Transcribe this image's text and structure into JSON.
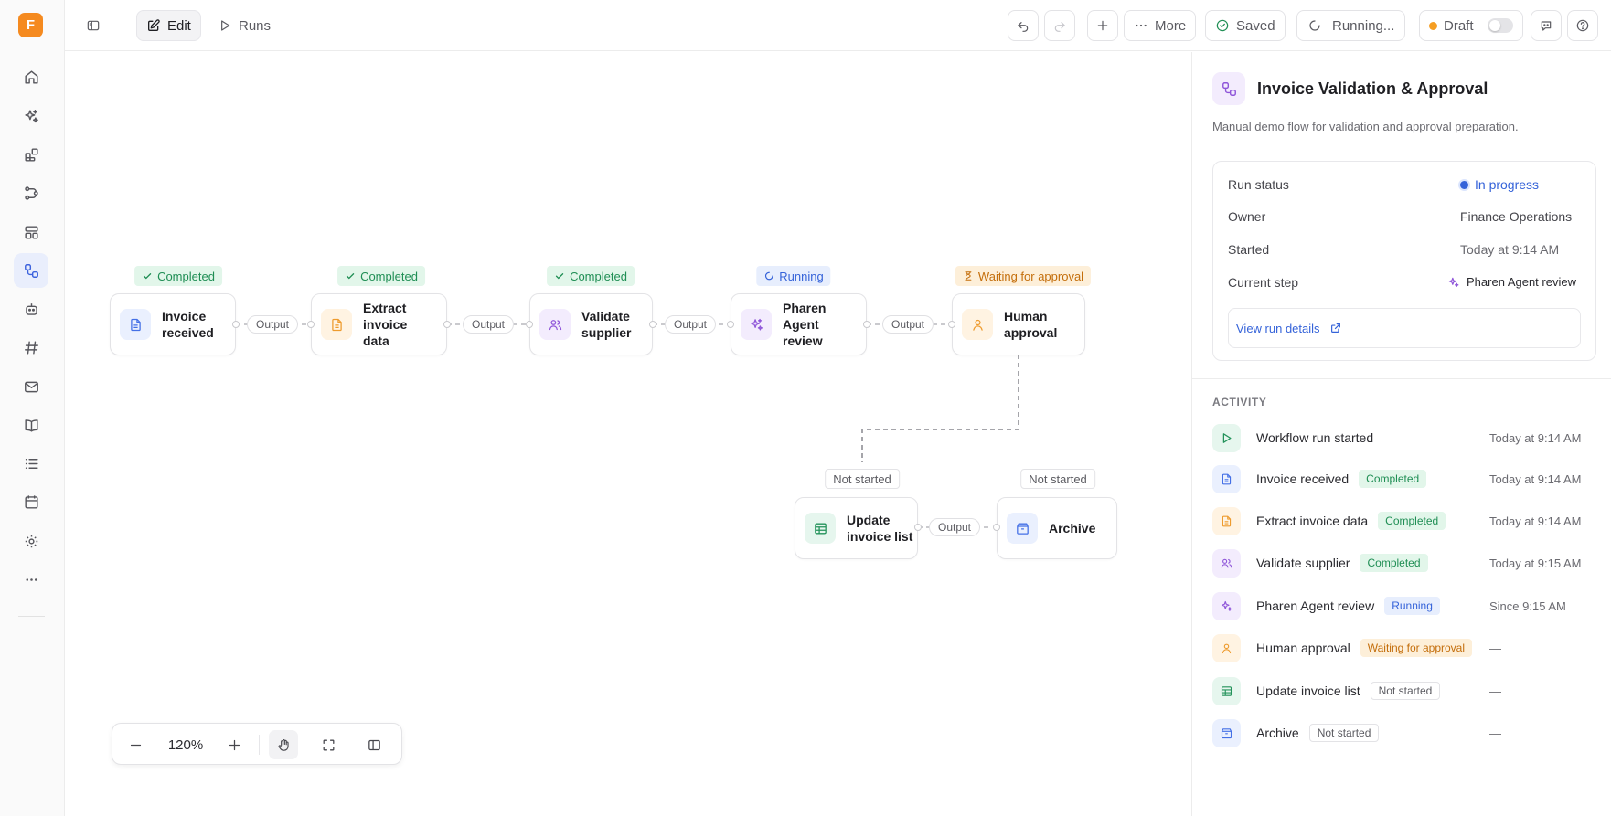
{
  "app": {
    "logo_letter": "F"
  },
  "rail": {
    "items": [
      {
        "icon": "home-icon"
      },
      {
        "icon": "sparkles-icon"
      },
      {
        "icon": "blocks-icon"
      },
      {
        "icon": "flows-icon"
      },
      {
        "icon": "templates-icon"
      },
      {
        "icon": "workflow-icon",
        "active": true
      },
      {
        "icon": "bot-icon"
      },
      {
        "icon": "hash-icon"
      },
      {
        "icon": "mail-icon"
      },
      {
        "icon": "book-icon"
      },
      {
        "icon": "list-icon"
      },
      {
        "icon": "calendar-icon"
      },
      {
        "icon": "settings-icon"
      },
      {
        "icon": "more-icon"
      }
    ]
  },
  "topbar": {
    "edit_label": "Edit",
    "runs_label": "Runs",
    "more_label": "More",
    "saved_label": "Saved",
    "running_label": "Running...",
    "draft_label": "Draft"
  },
  "canvas": {
    "nodes": [
      {
        "id": "invoice-received",
        "label": "Invoice received",
        "status": "Completed",
        "color": "blue",
        "icon": "document-icon"
      },
      {
        "id": "extract-invoice-data",
        "label": "Extract invoice data",
        "status": "Completed",
        "color": "orange",
        "icon": "document-icon"
      },
      {
        "id": "validate-supplier",
        "label": "Validate supplier",
        "status": "Completed",
        "color": "purple",
        "icon": "users-icon"
      },
      {
        "id": "pharen-agent-review",
        "label": "Pharen Agent review",
        "status": "Running",
        "color": "purple",
        "icon": "sparkles-icon"
      },
      {
        "id": "human-approval",
        "label": "Human approval",
        "status": "Waiting for approval",
        "color": "orange",
        "icon": "person-icon"
      },
      {
        "id": "update-invoice-list",
        "label": "Update invoice list",
        "status": "Not started",
        "color": "green",
        "icon": "table-icon"
      },
      {
        "id": "archive",
        "label": "Archive",
        "status": "Not started",
        "color": "blue",
        "icon": "archive-icon"
      }
    ],
    "edge_label": "Output",
    "zoom": "120%"
  },
  "panel": {
    "title": "Invoice Validation & Approval",
    "description": "Manual demo flow for validation and approval preparation.",
    "details": {
      "run_status_label": "Run status",
      "run_status_value": "In progress",
      "owner_label": "Owner",
      "owner_value": "Finance Operations",
      "started_label": "Started",
      "started_value": "Today at 9:14 AM",
      "current_step_label": "Current step",
      "current_step_value": "Pharen Agent review",
      "view_run_label": "View run details"
    },
    "activity_heading": "ACTIVITY",
    "activity": [
      {
        "name": "Workflow run started",
        "badge": "",
        "time": "Today at 9:14 AM",
        "color": "green",
        "icon": "play-icon"
      },
      {
        "name": "Invoice received",
        "badge": "Completed",
        "badge_type": "green",
        "time": "Today at 9:14 AM",
        "color": "blue",
        "icon": "document-icon"
      },
      {
        "name": "Extract invoice data",
        "badge": "Completed",
        "badge_type": "green",
        "time": "Today at 9:14 AM",
        "color": "orange",
        "icon": "document-icon"
      },
      {
        "name": "Validate supplier",
        "badge": "Completed",
        "badge_type": "green",
        "time": "Today at 9:15 AM",
        "color": "purple",
        "icon": "users-icon"
      },
      {
        "name": "Pharen Agent review",
        "badge": "Running",
        "badge_type": "blue",
        "time": "Since 9:15 AM",
        "color": "purple",
        "icon": "sparkles-icon"
      },
      {
        "name": "Human approval",
        "badge": "Waiting for approval",
        "badge_type": "amber",
        "time": "—",
        "color": "orange",
        "icon": "person-icon"
      },
      {
        "name": "Update invoice list",
        "badge": "Not started",
        "badge_type": "gray",
        "time": "—",
        "color": "green",
        "icon": "table-icon"
      },
      {
        "name": "Archive",
        "badge": "Not started",
        "badge_type": "gray",
        "time": "—",
        "color": "blue",
        "icon": "archive-icon"
      }
    ]
  },
  "colors": {
    "accent": "#3d63dd",
    "brand": "#f58a1f",
    "completed": "#1f8e54",
    "running": "#3563d9",
    "waiting": "#c46e0b"
  }
}
